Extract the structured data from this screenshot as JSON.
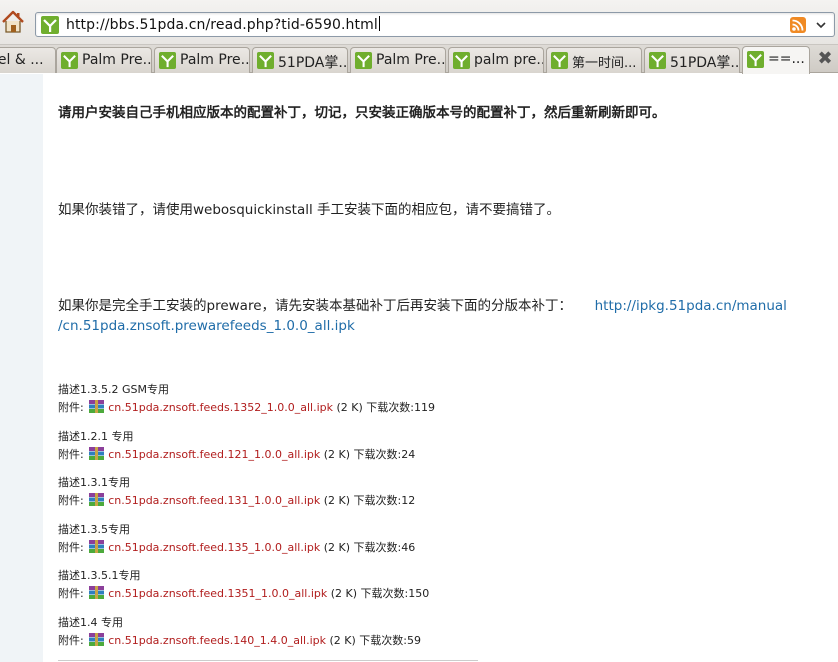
{
  "browser": {
    "url": "http://bbs.51pda.cn/read.php?tid-6590.html",
    "tabs": [
      {
        "label": "bel & ...",
        "active": false
      },
      {
        "label": "Palm Pre...",
        "active": false
      },
      {
        "label": "Palm Pre...",
        "active": false
      },
      {
        "label": "51PDA掌...",
        "active": false
      },
      {
        "label": "Palm Pre...",
        "active": false
      },
      {
        "label": "palm pre...",
        "active": false
      },
      {
        "label": "第一时间...",
        "active": false
      },
      {
        "label": "51PDA掌...",
        "active": false
      },
      {
        "label": "==...",
        "active": true
      }
    ]
  },
  "post": {
    "instruction": "请用户安装自己手机相应版本的配置补丁，切记，只安装正确版本号的配置补丁，然后重新刷新即可。",
    "wrong_install_note": "如果你装错了，请使用webosquickinstall 手工安装下面的相应包，请不要搞错了。",
    "manual_note": "如果你是完全手工安装的preware，请先安装本基础补丁后再安装下面的分版本补丁：",
    "manual_link_line1": "http://ipkg.51pda.cn/manual",
    "manual_link_line2": "/cn.51pda.znsoft.prewarefeeds_1.0.0_all.ipk",
    "attachment_prefix": "附件: ",
    "attachments": [
      {
        "desc": "描述1.3.5.2 GSM专用",
        "file": "cn.51pda.znsoft.feeds.1352_1.0.0_all.ipk",
        "size": " (2 K) ",
        "downloads": "下载次数:119"
      },
      {
        "desc": "描述1.2.1 专用",
        "file": "cn.51pda.znsoft.feed.121_1.0.0_all.ipk",
        "size": " (2 K) ",
        "downloads": "下载次数:24"
      },
      {
        "desc": "描述1.3.1专用",
        "file": "cn.51pda.znsoft.feed.131_1.0.0_all.ipk",
        "size": " (2 K) ",
        "downloads": "下载次数:12"
      },
      {
        "desc": "描述1.3.5专用",
        "file": "cn.51pda.znsoft.feed.135_1.0.0_all.ipk",
        "size": " (2 K) ",
        "downloads": "下载次数:46"
      },
      {
        "desc": "描述1.3.5.1专用",
        "file": "cn.51pda.znsoft.feed.1351_1.0.0_all.ipk",
        "size": " (2 K) ",
        "downloads": "下载次数:150"
      },
      {
        "desc": "描述1.4 专用",
        "file": "cn.51pda.znsoft.feeds.140_1.4.0_all.ipk",
        "size": " (2 K) ",
        "downloads": "下载次数:59"
      }
    ]
  },
  "icons": {
    "home": "home-icon",
    "favicon": "palm-favicon-icon",
    "rss": "rss-feed-icon",
    "attachment": "winrar-archive-icon",
    "close_tabs": "close-icon"
  },
  "colors": {
    "link": "#1f6ca8",
    "attachment_file": "#b11d1d",
    "page_margin": "#f0f4f7",
    "favicon_green": "#6fae2e"
  }
}
